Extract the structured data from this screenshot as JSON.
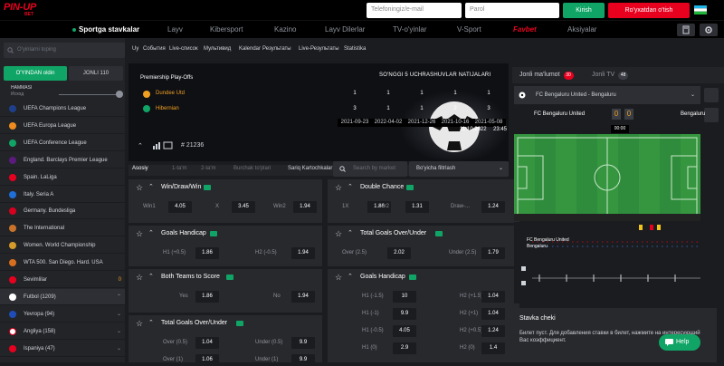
{
  "header": {
    "logo_main": "PIN-UP",
    "logo_sub": "BET",
    "phone_placeholder": "Telefoningiz/e-mail",
    "password_placeholder": "Parol",
    "login_label": "Kirish",
    "register_label": "Ro'yxatdan o'tish"
  },
  "nav": {
    "items": [
      "Sportga stavkalar",
      "Layv",
      "Kibersport",
      "Kazino",
      "Layv Dilerlar",
      "TV-o'yinlar",
      "V-Sport",
      "Aksiyalar"
    ],
    "favbet": "Favbet"
  },
  "subnav": {
    "items": [
      "Uy",
      "События",
      "Live-список",
      "Мультивид",
      "Kalendar",
      "Результаты",
      "Live-Результаты",
      "Statistika"
    ]
  },
  "sidebar": {
    "search_placeholder": "O'yinlarni toping",
    "tab_before": "O'YINDAN oldin",
    "tab_live": "JONLI",
    "tab_live_count": "110",
    "filter_label": "HAMMASI",
    "filter_sub": "Исход",
    "leagues": [
      "UEFA Champions League",
      "UEFA Europa League",
      "UEFA Conference League",
      "England. Barclays Premier League",
      "Spain. LaLiga",
      "Italy. Seria A",
      "Germany. Bundesliga",
      "The International",
      "Women. World Championship",
      "WTA 500. San Diego. Hard. USA"
    ],
    "favorites": "Sevimlilar",
    "favorites_count": "0",
    "sports": [
      {
        "name": "Futbol (1209)"
      },
      {
        "name": "Yevropa (94)"
      },
      {
        "name": "Angliya (158)"
      },
      {
        "name": "Ispaniya (47)"
      }
    ]
  },
  "match": {
    "competition": "Premiership Play-Offs",
    "history_title": "SO'NGGI 5 UCHRASHUVLAR NATIJALARI",
    "team1": "Dundee Utd",
    "team2": "Hibernian",
    "team1_scores": [
      "1",
      "1",
      "1",
      "1",
      "1"
    ],
    "team2_scores": [
      "3",
      "1",
      "1",
      "2",
      "3"
    ],
    "dates": [
      "2021-09-23",
      "2022-04-02",
      "2021-12-26",
      "2021-10-16",
      "2021-05-08"
    ],
    "current_date": "11.10.2022",
    "current_time": "23:45",
    "match_id": "# 21236"
  },
  "market_bar": {
    "tabs": [
      "Asosiy",
      "1-ta'm",
      "2-ta'm",
      "Burchak to'plari",
      "Sariq Kartochkalar"
    ],
    "search_placeholder": "Search by market",
    "filter_label": "Bo'yicha filtrlash"
  },
  "markets": [
    {
      "title": "Win/Draw/Win",
      "odds": [
        {
          "label": "Win1",
          "value": "4.05"
        },
        {
          "label": "X",
          "value": "3.45"
        },
        {
          "label": "Win2",
          "value": "1.94"
        }
      ]
    },
    {
      "title": "Double Chance",
      "odds": [
        {
          "label": "1X",
          "value": "1.86"
        },
        {
          "label": "1or2",
          "value": "1.31"
        },
        {
          "label": "Draw-...",
          "value": "1.24"
        }
      ]
    },
    {
      "title": "Goals Handicap",
      "odds": [
        {
          "label": "H1 (+0.5)",
          "value": "1.86"
        },
        {
          "label": "H2 (-0.5)",
          "value": "1.94"
        }
      ]
    },
    {
      "title": "Total Goals Over/Under",
      "odds": [
        {
          "label": "Over (2.5)",
          "value": "2.02"
        },
        {
          "label": "Under (2.5)",
          "value": "1.79"
        }
      ]
    },
    {
      "title": "Both Teams to Score",
      "odds": [
        {
          "label": "Yes",
          "value": "1.86"
        },
        {
          "label": "No",
          "value": "1.94"
        }
      ]
    },
    {
      "title": "Goals Handicap",
      "odds": [
        {
          "label": "H1 (-1.5)",
          "value": "10"
        },
        {
          "label": "H2 (+1.5)",
          "value": "1.04"
        },
        {
          "label": "H1 (-1)",
          "value": "9.9"
        },
        {
          "label": "H2 (+1)",
          "value": "1.04"
        },
        {
          "label": "H1 (-0.5)",
          "value": "4.05"
        },
        {
          "label": "H2 (+0.5)",
          "value": "1.24"
        },
        {
          "label": "H1 (0)",
          "value": "2.9"
        },
        {
          "label": "H2 (0)",
          "value": "1.4"
        }
      ]
    },
    {
      "title": "Total Goals Over/Under",
      "odds": [
        {
          "label": "Over (0.5)",
          "value": "1.04"
        },
        {
          "label": "Under (0.5)",
          "value": "9.9"
        },
        {
          "label": "Over (1)",
          "value": "1.06"
        },
        {
          "label": "Under (1)",
          "value": "9.9"
        }
      ]
    }
  ],
  "right_panel": {
    "tab_info": "Jonli ma'lumot",
    "tab_info_count": "30",
    "tab_tv": "Jonli TV",
    "tab_tv_count": "48",
    "match_title": "FC Bengaluru United - Bengaluru",
    "home": "FC Bengaluru United",
    "away": "Bengaluru",
    "home_score": "0",
    "away_score": "0",
    "clock": "00:00",
    "tl_home": "FC Bengaluru United",
    "tl_away": "Bengaluru",
    "slip_title": "Stavka cheki",
    "slip_text": "Билет пуст. Для добавления ставки в билет, нажмите на интересующий Вас коэффициент.",
    "help_label": "Help"
  },
  "colors": {
    "brand_red": "#e8001f",
    "accent_green": "#10a566",
    "odds_bg": "#1b1c20"
  }
}
